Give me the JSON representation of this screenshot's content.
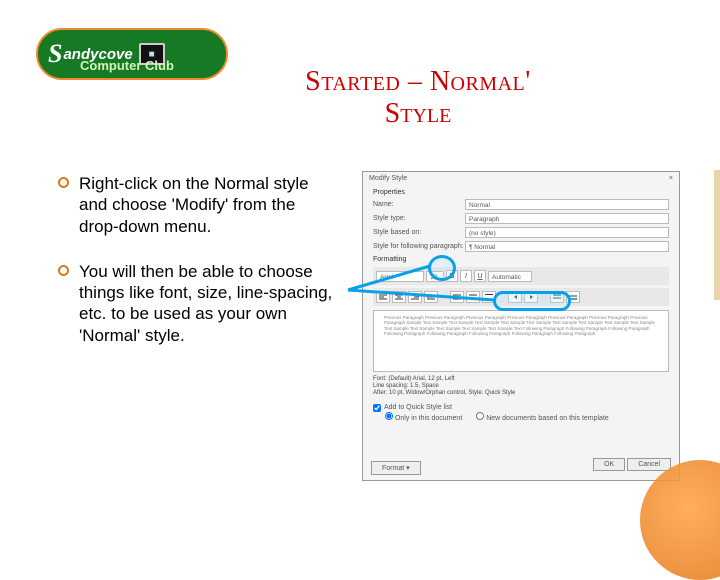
{
  "logo": {
    "wordmark_s": "S",
    "wordmark_rest": "andycove",
    "sub": "Computer Club",
    "monitor": "■"
  },
  "title": {
    "line1": "Started – Normal'",
    "line2": "Style"
  },
  "bullets": [
    "Right-click on the Normal style and choose 'Modify' from the drop-down menu.",
    "You will then be able to choose things like font, size, line-spacing, etc. to be used as your own 'Normal' style."
  ],
  "dialog": {
    "title": "Modify Style",
    "close": "×",
    "section1": "Properties",
    "name_label": "Name:",
    "name_value": "Normal",
    "type_label": "Style type:",
    "type_value": "Paragraph",
    "based_label": "Style based on:",
    "based_value": "(no style)",
    "follow_label": "Style for following paragraph:",
    "follow_value": "¶ Normal",
    "section2": "Formatting",
    "font": "Arial",
    "size": "12",
    "bold": "B",
    "italic": "I",
    "underline": "U",
    "color": "Automatic",
    "preview_text": "Previous Paragraph Previous Paragraph Previous Paragraph Previous Paragraph Previous Paragraph Previous Paragraph Previous Paragraph  Sample Text Sample Text Sample Text Sample Text Sample Text Sample Text Sample Text Sample Text Sample Text Sample Text Sample Text Sample Text Sample Text Sample Text Sample Text  Following Paragraph Following Paragraph Following Paragraph Following Paragraph Following Paragraph Following Paragraph Following Paragraph Following Paragraph",
    "summary1": "Font: (Default) Arial, 12 pt, Left",
    "summary2": "Line spacing: 1.5, Space",
    "summary3": "After: 10 pt, Widow/Orphan control, Style: Quick Style",
    "chk_quick": "Add to Quick Style list",
    "rad_only": "Only in this document",
    "rad_new": "New documents based on this template",
    "format_btn": "Format ▾",
    "ok": "OK",
    "cancel": "Cancel"
  }
}
